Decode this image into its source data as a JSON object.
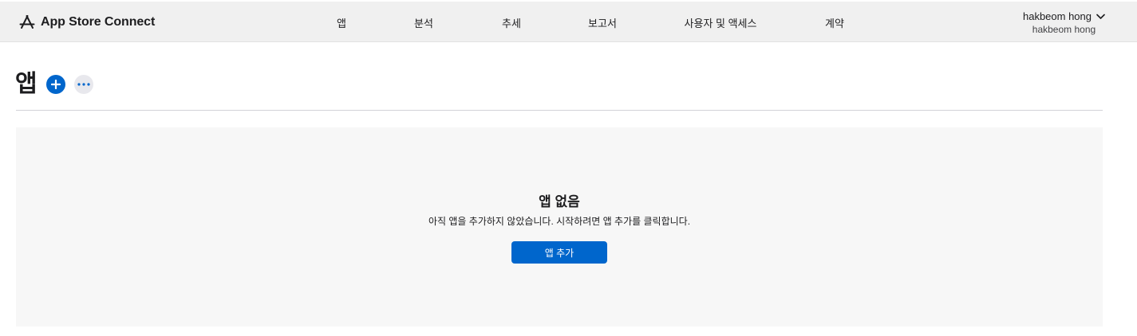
{
  "brand": {
    "name": "App Store Connect",
    "icon": "app-store-icon"
  },
  "nav": {
    "items": [
      {
        "label": "앱"
      },
      {
        "label": "분석"
      },
      {
        "label": "추세"
      },
      {
        "label": "보고서"
      },
      {
        "label": "사용자 및 액세스"
      },
      {
        "label": "계약"
      }
    ]
  },
  "account": {
    "name": "hakbeom hong",
    "team": "hakbeom hong",
    "icon": "chevron-down-icon"
  },
  "page": {
    "title": "앱",
    "add_icon": "plus-icon",
    "more_icon": "ellipsis-icon"
  },
  "empty_state": {
    "title": "앱 없음",
    "description": "아직 앱을 추가하지 않았습니다. 시작하려면 앱 추가를 클릭합니다.",
    "button_label": "앱 추가"
  },
  "colors": {
    "accent": "#0066cc",
    "topbar_bg": "#f0f0f0",
    "panel_bg": "#f7f7f7",
    "divider": "#d2d2d7"
  }
}
